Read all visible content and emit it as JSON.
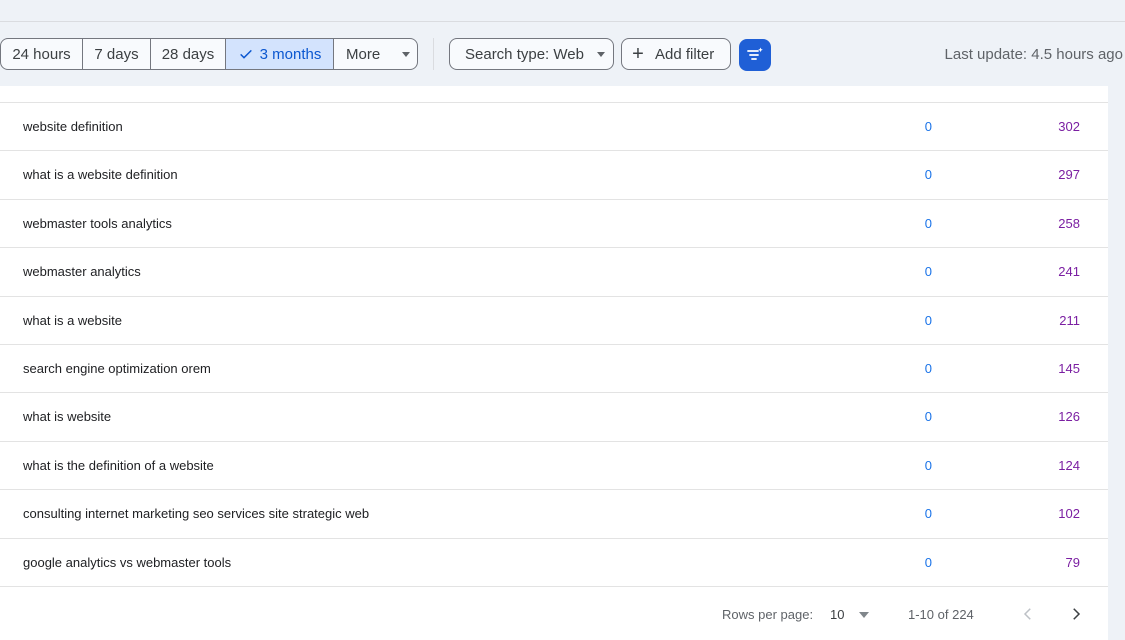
{
  "toolbar": {
    "ranges": [
      "24 hours",
      "7 days",
      "28 days",
      "3 months",
      "More"
    ],
    "selected_range": "3 months",
    "search_type": "Search type: Web",
    "add_filter": "Add filter",
    "last_update": "Last update: 4.5 hours ago"
  },
  "rows": [
    {
      "query": "website definition",
      "clicks": "0",
      "impressions": "302"
    },
    {
      "query": "what is a website definition",
      "clicks": "0",
      "impressions": "297"
    },
    {
      "query": "webmaster tools analytics",
      "clicks": "0",
      "impressions": "258"
    },
    {
      "query": "webmaster analytics",
      "clicks": "0",
      "impressions": "241"
    },
    {
      "query": "what is a website",
      "clicks": "0",
      "impressions": "211"
    },
    {
      "query": "search engine optimization orem",
      "clicks": "0",
      "impressions": "145"
    },
    {
      "query": "what is website",
      "clicks": "0",
      "impressions": "126"
    },
    {
      "query": "what is the definition of a website",
      "clicks": "0",
      "impressions": "124"
    },
    {
      "query": "consulting internet marketing seo services site strategic web",
      "clicks": "0",
      "impressions": "102"
    },
    {
      "query": "google analytics vs webmaster tools",
      "clicks": "0",
      "impressions": "79"
    }
  ],
  "pagination": {
    "rows_per_page_label": "Rows per page:",
    "rows_per_page": "10",
    "range": "1-10 of 224"
  },
  "colors": {
    "accent": "#1f5fd6",
    "selected_bg": "#d3e3fd",
    "clicks": "#1a73e8",
    "impressions": "#7b1fa2"
  }
}
